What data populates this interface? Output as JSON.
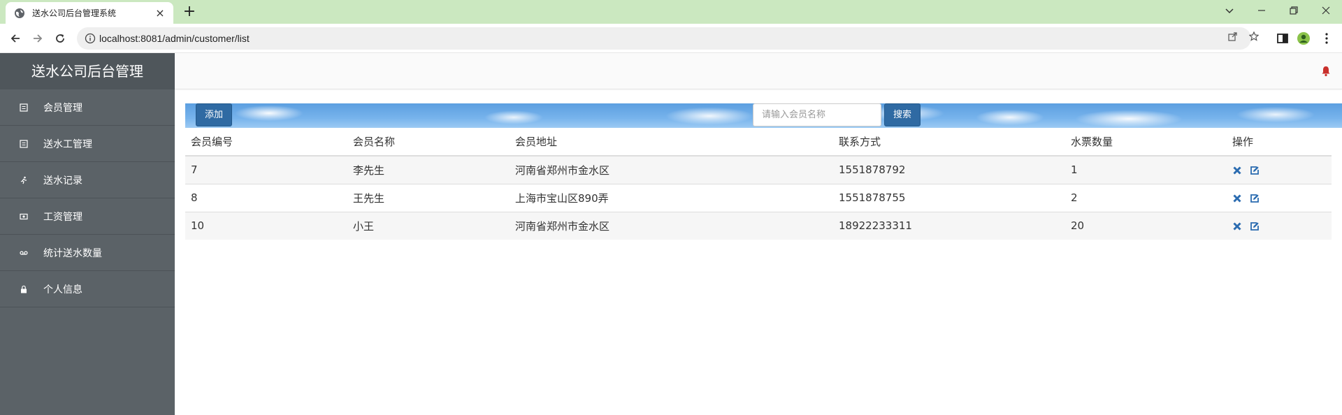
{
  "browser": {
    "tab_title": "送水公司后台管理系统",
    "tab_close": "×",
    "new_tab": "+",
    "url": "localhost:8081/admin/customer/list"
  },
  "sidebar": {
    "brand": "送水公司后台管理",
    "items": [
      {
        "label": "会员管理",
        "icon": "list-icon"
      },
      {
        "label": "送水工管理",
        "icon": "list-icon"
      },
      {
        "label": "送水记录",
        "icon": "runner-icon"
      },
      {
        "label": "工资管理",
        "icon": "money-icon"
      },
      {
        "label": "统计送水数量",
        "icon": "voicemail-icon"
      },
      {
        "label": "个人信息",
        "icon": "lock-icon"
      }
    ]
  },
  "toolbar": {
    "add_label": "添加",
    "search_placeholder": "请输入会员名称",
    "search_label": "搜索"
  },
  "table": {
    "headers": [
      "会员编号",
      "会员名称",
      "会员地址",
      "联系方式",
      "水票数量",
      "操作"
    ],
    "rows": [
      {
        "id": "7",
        "name": "李先生",
        "address": "河南省郑州市金水区",
        "phone": "1551878792",
        "tickets": "1"
      },
      {
        "id": "8",
        "name": "王先生",
        "address": "上海市宝山区890弄",
        "phone": "1551878755",
        "tickets": "2"
      },
      {
        "id": "10",
        "name": "小王",
        "address": "河南省郑州市金水区",
        "phone": "18922233311",
        "tickets": "20"
      }
    ]
  },
  "colors": {
    "sidebar_bg": "#5b6267",
    "primary_button": "#2f6aa3",
    "chrome_tabbar": "#cbe8c0",
    "bell": "#c9302c"
  }
}
